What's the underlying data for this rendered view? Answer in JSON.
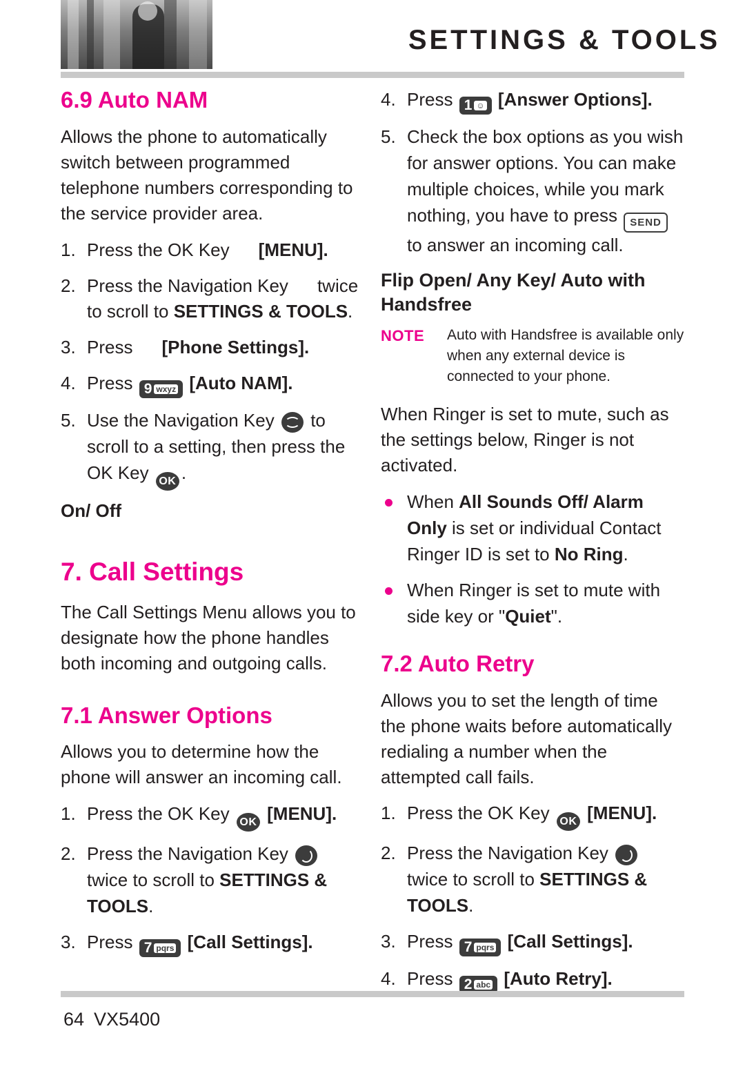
{
  "header": {
    "title": "SETTINGS & TOOLS",
    "photo_alt": "header-photo"
  },
  "left_column": {
    "section_69_title": "6.9 Auto NAM",
    "section_69_intro": "Allows the phone to automatically switch between programmed telephone numbers corresponding to the service provider area.",
    "section_69_steps": [
      {
        "num": "1.",
        "pre": "Press the OK Key",
        "key": "",
        "post": "[MENU]."
      },
      {
        "num": "2.",
        "pre": "Press the Navigation Key",
        "key": "nav",
        "post": "twice to scroll to ",
        "bold": "SETTINGS & TOOLS",
        "tail": "."
      },
      {
        "num": "3.",
        "pre": "Press",
        "key": "",
        "post": "[Phone Settings]."
      },
      {
        "num": "4.",
        "pre": "Press",
        "key": "9wxyz",
        "post": "[Auto NAM]."
      },
      {
        "num": "5.",
        "pre": "Use the Navigation Key",
        "key": "nav-vert",
        "post": "to scroll to a setting, then press the OK Key",
        "key2": "OK",
        "tail": "."
      }
    ],
    "section_69_onoff": "On/ Off",
    "chapter_7_title": "7. Call Settings",
    "chapter_7_intro": "The Call Settings Menu allows you to designate how the phone handles both incoming and outgoing calls.",
    "section_71_title": "7.1 Answer Options",
    "section_71_intro": "Allows you to determine how the phone will answer an incoming call.",
    "section_71_steps": [
      {
        "num": "1.",
        "pre": "Press the OK Key",
        "key": "OK",
        "post": "[MENU]."
      },
      {
        "num": "2.",
        "pre": "Press the Navigation Key",
        "key": "nav",
        "post": "twice to scroll to ",
        "bold": "SETTINGS & TOOLS",
        "tail": "."
      },
      {
        "num": "3.",
        "pre": "Press",
        "key": "7pqrs",
        "post": "[Call Settings]."
      }
    ]
  },
  "right_column": {
    "step4_num": "4.",
    "step4_pre": "Press",
    "step4_key": "1",
    "step4_post": "[Answer Options].",
    "step5_num": "5.",
    "step5_text_a": "Check the box options as you wish for answer options. You can make multiple choices, while you mark nothing, you have to press",
    "step5_key": "SEND",
    "step5_text_b": "to answer an incoming call.",
    "subhead_flip": "Flip Open/ Any Key/ Auto with Handsfree",
    "note_label": "NOTE",
    "note_text": "Auto with Handsfree is available only when any external device is connected to your phone.",
    "ringer_intro": "When Ringer is set to mute, such as the settings below, Ringer is not activated.",
    "bullets": [
      {
        "pre": "When ",
        "bold1": "All Sounds Off/ Alarm Only",
        "mid": " is set or individual Contact Ringer ID is set to ",
        "bold2": "No Ring",
        "tail": "."
      },
      {
        "pre": "When Ringer is set to mute with side key or \"",
        "bold1": "Quiet",
        "mid": "\".",
        "bold2": "",
        "tail": ""
      }
    ],
    "section_72_title": "7.2 Auto Retry",
    "section_72_intro": "Allows you to set the length of time the phone waits before automatically redialing a number when the attempted call fails.",
    "section_72_steps": [
      {
        "num": "1.",
        "pre": "Press the OK Key",
        "key": "OK",
        "post": "[MENU]."
      },
      {
        "num": "2.",
        "pre": "Press the Navigation Key",
        "key": "nav",
        "post": "twice to scroll to ",
        "bold": "SETTINGS & TOOLS",
        "tail": "."
      },
      {
        "num": "3.",
        "pre": "Press",
        "key": "7pqrs",
        "post": "[Call Settings]."
      },
      {
        "num": "4.",
        "pre": "Press",
        "key": "2abc",
        "post": "[Auto Retry]."
      }
    ]
  },
  "footer": {
    "page_number": "64",
    "model": "VX5400"
  },
  "colors": {
    "accent": "#ec008c",
    "text": "#231f20",
    "rule": "#c9c9c9"
  }
}
